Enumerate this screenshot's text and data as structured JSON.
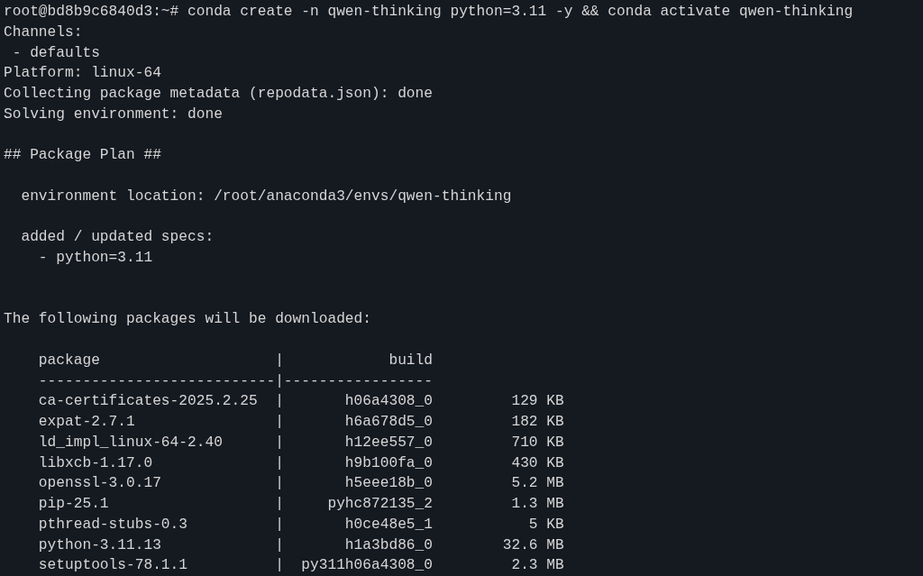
{
  "terminal": {
    "lines": [
      {
        "kind": "text",
        "text": "root@bd8b9c6840d3:~# conda create -n qwen-thinking python=3.11 -y && conda activate qwen-thinking"
      },
      {
        "kind": "text",
        "text": "Channels:"
      },
      {
        "kind": "text",
        "text": " - defaults"
      },
      {
        "kind": "text",
        "text": "Platform: linux-64"
      },
      {
        "kind": "text",
        "text": "Collecting package metadata (repodata.json): done"
      },
      {
        "kind": "text",
        "text": "Solving environment: done"
      },
      {
        "kind": "blank"
      },
      {
        "kind": "text",
        "text": "## Package Plan ##"
      },
      {
        "kind": "blank"
      },
      {
        "kind": "text",
        "text": "  environment location: /root/anaconda3/envs/qwen-thinking"
      },
      {
        "kind": "blank"
      },
      {
        "kind": "text",
        "text": "  added / updated specs:"
      },
      {
        "kind": "text",
        "text": "    - python=3.11"
      },
      {
        "kind": "blank"
      },
      {
        "kind": "blank"
      },
      {
        "kind": "text",
        "text": "The following packages will be downloaded:"
      },
      {
        "kind": "blank"
      },
      {
        "kind": "text",
        "text": "    package                    |            build"
      },
      {
        "kind": "text",
        "text": "    ---------------------------|-----------------"
      },
      {
        "kind": "text",
        "text": "    ca-certificates-2025.2.25  |       h06a4308_0         129 KB"
      },
      {
        "kind": "text",
        "text": "    expat-2.7.1                |       h6a678d5_0         182 KB"
      },
      {
        "kind": "text",
        "text": "    ld_impl_linux-64-2.40      |       h12ee557_0         710 KB"
      },
      {
        "kind": "text",
        "text": "    libxcb-1.17.0              |       h9b100fa_0         430 KB"
      },
      {
        "kind": "text",
        "text": "    openssl-3.0.17             |       h5eee18b_0         5.2 MB"
      },
      {
        "kind": "text",
        "text": "    pip-25.1                   |     pyhc872135_2         1.3 MB"
      },
      {
        "kind": "text",
        "text": "    pthread-stubs-0.3          |       h0ce48e5_1           5 KB"
      },
      {
        "kind": "text",
        "text": "    python-3.11.13             |       h1a3bd86_0        32.6 MB"
      },
      {
        "kind": "text",
        "text": "    setuptools-78.1.1          |  py311h06a4308_0         2.3 MB"
      }
    ]
  }
}
